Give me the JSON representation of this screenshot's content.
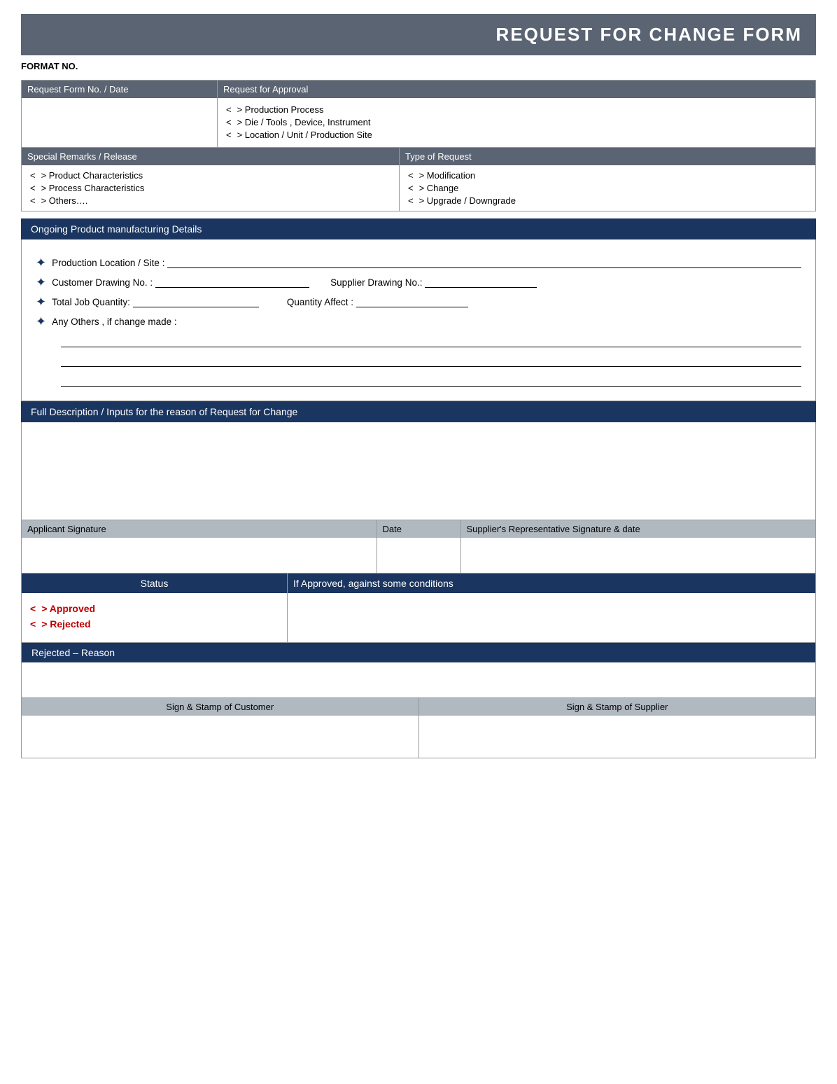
{
  "title": "REQUEST FOR CHANGE FORM",
  "format_no_label": "FORMAT NO.",
  "top": {
    "request_form_header": "Request Form No. / Date",
    "request_approval_header": "Request for Approval",
    "approval_items": [
      "> Production Process",
      "> Die / Tools , Device, Instrument",
      "> Location / Unit / Production Site"
    ]
  },
  "middle": {
    "special_remarks_header": "Special Remarks / Release",
    "remarks_items": [
      "> Product Characteristics",
      "> Process Characteristics",
      "> Others…."
    ],
    "type_request_header": "Type of Request",
    "type_items": [
      "> Modification",
      "> Change",
      "> Upgrade / Downgrade"
    ]
  },
  "ongoing_header": "Ongoing Product manufacturing Details",
  "fields": {
    "production_location": "Production Location / Site :",
    "customer_drawing": "Customer Drawing No. :",
    "supplier_drawing": "Supplier Drawing No.:",
    "total_job_quantity": "Total Job Quantity:",
    "quantity_affect": "Quantity Affect :",
    "any_others": "Any Others , if change made :"
  },
  "full_desc_header": "Full Description / Inputs for the reason of Request for Change",
  "signature": {
    "applicant": "Applicant Signature",
    "date": "Date",
    "supplier_rep": "Supplier's Representative Signature & date"
  },
  "status": {
    "header": "Status",
    "items": [
      "> Approved",
      "> Rejected"
    ],
    "if_approved_header": "If Approved,  against some conditions"
  },
  "rejected_reason": {
    "header": "Rejected – Reason"
  },
  "stamp": {
    "customer": "Sign & Stamp of Customer",
    "supplier": "Sign & Stamp of Supplier"
  },
  "icons": {
    "arrow_down_icon": "✦",
    "bracket_left": "<"
  }
}
